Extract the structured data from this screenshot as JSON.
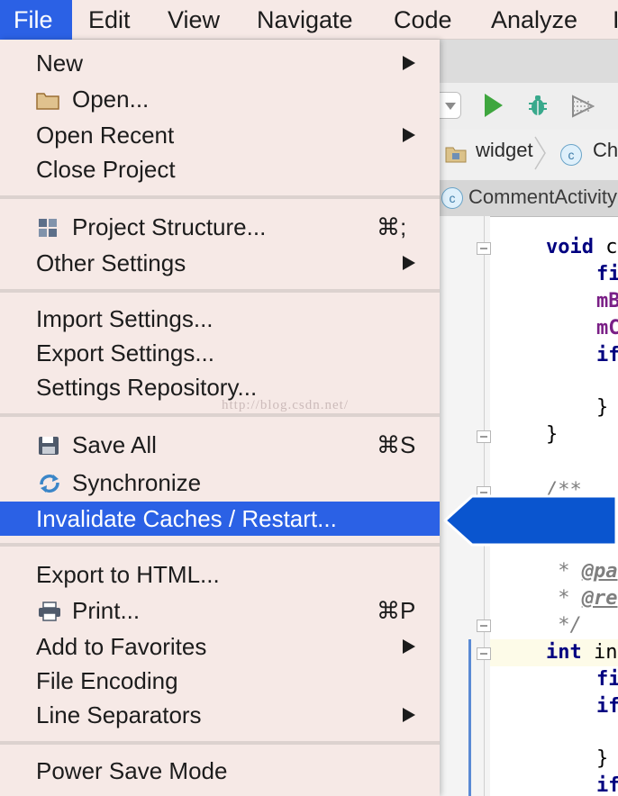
{
  "menubar": {
    "items": [
      "File",
      "Edit",
      "View",
      "Navigate",
      "Code",
      "Analyze"
    ],
    "cutoff": "I"
  },
  "file_menu": {
    "new": "New",
    "open": "Open...",
    "open_recent": "Open Recent",
    "close_project": "Close Project",
    "project_structure": "Project Structure...",
    "project_structure_shortcut": "⌘;",
    "other_settings": "Other Settings",
    "import_settings": "Import Settings...",
    "export_settings": "Export Settings...",
    "settings_repository": "Settings Repository...",
    "save_all": "Save All",
    "save_all_shortcut": "⌘S",
    "synchronize": "Synchronize",
    "invalidate_caches": "Invalidate Caches / Restart...",
    "export_html": "Export to HTML...",
    "print": "Print...",
    "print_shortcut": "⌘P",
    "add_favorites": "Add to Favorites",
    "file_encoding": "File Encoding",
    "line_separators": "Line Separators",
    "power_save": "Power Save Mode"
  },
  "watermark": "http://blog.csdn.net/",
  "ide": {
    "breadcrumb_folder": "widget",
    "breadcrumb_class": "Ch",
    "tab_title": "CommentActivity",
    "class_badge": "c",
    "code": {
      "l1_kw": "void",
      "l1_rest": " c",
      "l2": "fi",
      "l3": "mB",
      "l4": "mC",
      "l5": "if",
      "l6": "}",
      "l7": "}",
      "l8": "/**",
      "l9_prefix": " * ",
      "l9_tag": "@pa",
      "l10_prefix": " * ",
      "l10_tag": "@re",
      "l11": " */",
      "l12_kw": "int",
      "l12_rest": " in",
      "l13": "fi",
      "l14": "if",
      "l15": "}",
      "l16": "if"
    }
  },
  "colors": {
    "menu_bg": "#f6e9e6",
    "selection": "#2b61e5",
    "callout": "#0a55cf",
    "keyword": "#000080",
    "field": "#7a1f86",
    "run_green": "#3ea63e",
    "debug_green": "#39a98c"
  }
}
